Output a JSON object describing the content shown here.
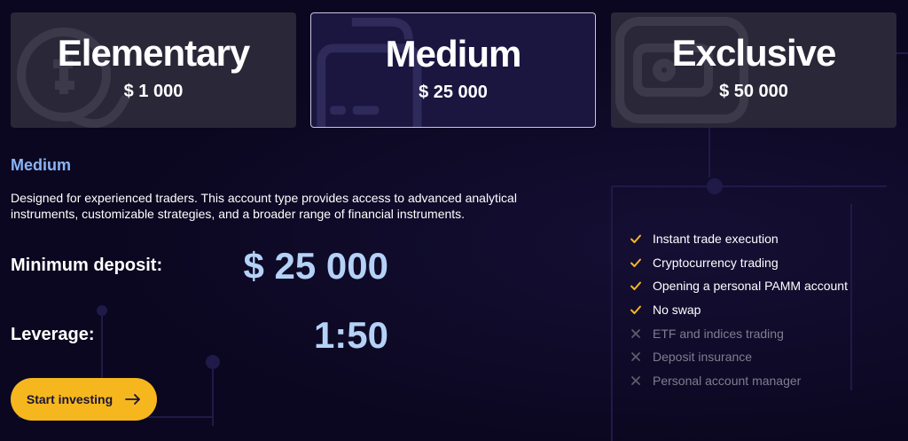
{
  "plans": [
    {
      "name": "Elementary",
      "price": "$ 1 000",
      "selected": false
    },
    {
      "name": "Medium",
      "price": "$ 25 000",
      "selected": true
    },
    {
      "name": "Exclusive",
      "price": "$ 50 000",
      "selected": false
    }
  ],
  "detail": {
    "title": "Medium",
    "description": "Designed for experienced traders. This account type provides access to advanced analytical instruments, customizable strategies, and a broader range of financial instruments.",
    "deposit_label": "Minimum deposit:",
    "deposit_value": "$ 25 000",
    "leverage_label": "Leverage:",
    "leverage_value": "1:50",
    "cta_label": "Start investing"
  },
  "features": [
    {
      "label": "Instant trade execution",
      "included": true,
      "icon": "check-icon"
    },
    {
      "label": "Cryptocurrency trading",
      "included": true,
      "icon": "check-icon"
    },
    {
      "label": "Opening a personal PAMM account",
      "included": true,
      "icon": "check-icon"
    },
    {
      "label": "No swap",
      "included": true,
      "icon": "check-icon"
    },
    {
      "label": "ETF and indices trading",
      "included": false,
      "icon": "cross-icon"
    },
    {
      "label": "Deposit insurance",
      "included": false,
      "icon": "cross-icon"
    },
    {
      "label": "Personal account manager",
      "included": false,
      "icon": "cross-icon"
    }
  ],
  "colors": {
    "accent_yellow": "#f6b71e",
    "title_blue": "#8ab4f8",
    "value_blue": "#b4d2f7",
    "check_yellow": "#f6b71e",
    "cross_gray": "#5e5c6e",
    "background": "#0b0720"
  }
}
